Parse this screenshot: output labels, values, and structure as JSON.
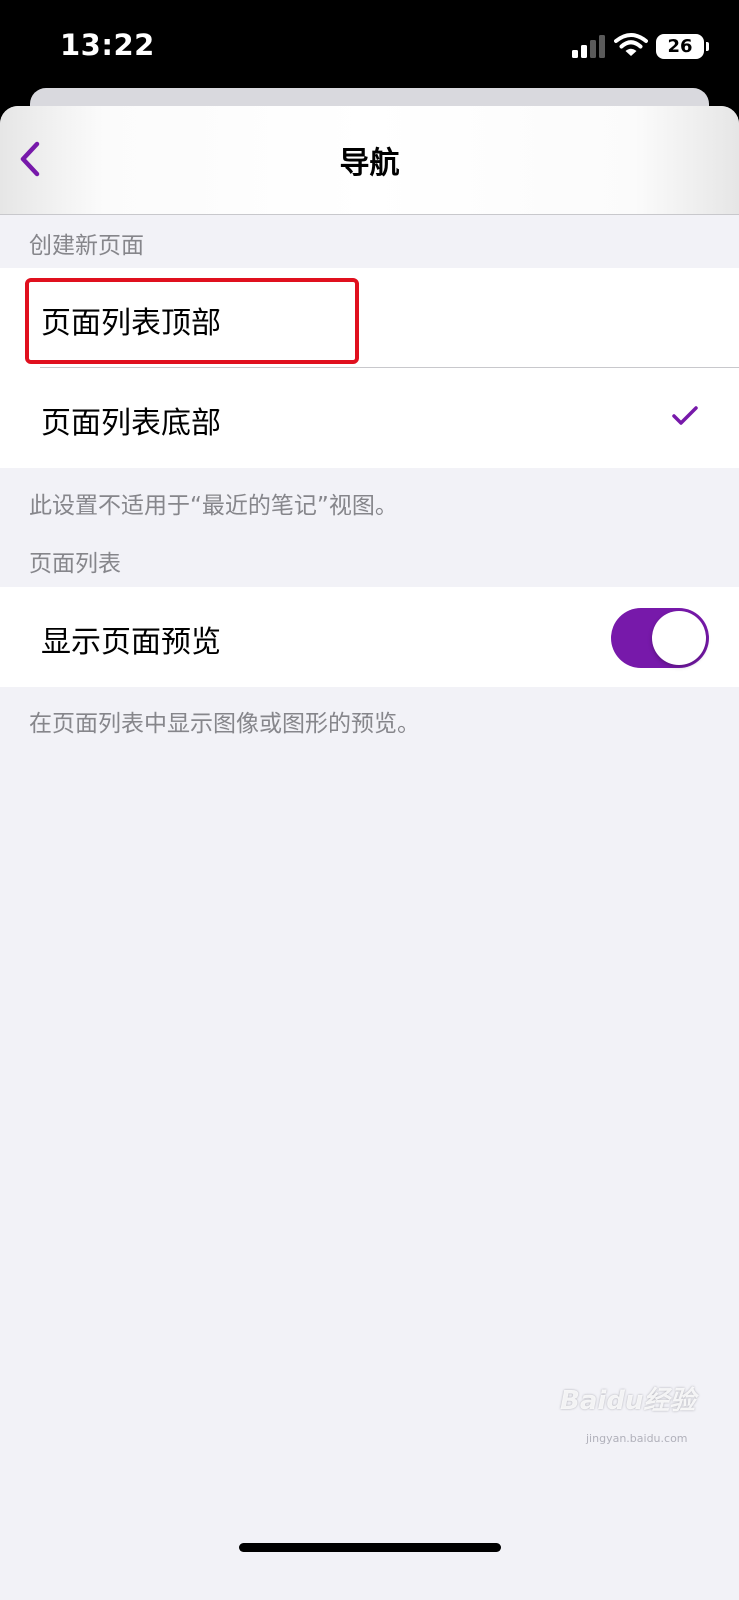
{
  "status_bar": {
    "time": "13:22",
    "battery": "26",
    "icons": [
      "signal-icon",
      "wifi-icon",
      "battery-icon"
    ]
  },
  "nav": {
    "title": "导航",
    "back_icon": "chevron-left-icon"
  },
  "sections": {
    "create_new_page": {
      "header": "创建新页面",
      "options": [
        {
          "label": "页面列表顶部",
          "selected": false,
          "highlighted": true
        },
        {
          "label": "页面列表底部",
          "selected": true
        }
      ],
      "footer": "此设置不适用于“最近的笔记”视图。"
    },
    "page_list": {
      "header": "页面列表",
      "toggle": {
        "label": "显示页面预览",
        "on": true
      },
      "footer": "在页面列表中显示图像或图形的预览。"
    }
  },
  "watermark": {
    "brand": "Baidu经验",
    "site": "jingyan.baidu.com"
  },
  "colors": {
    "accent": "#7719aa",
    "highlight_border": "#e0101e",
    "background": "#f2f2f7",
    "secondary_text": "#86868b"
  }
}
